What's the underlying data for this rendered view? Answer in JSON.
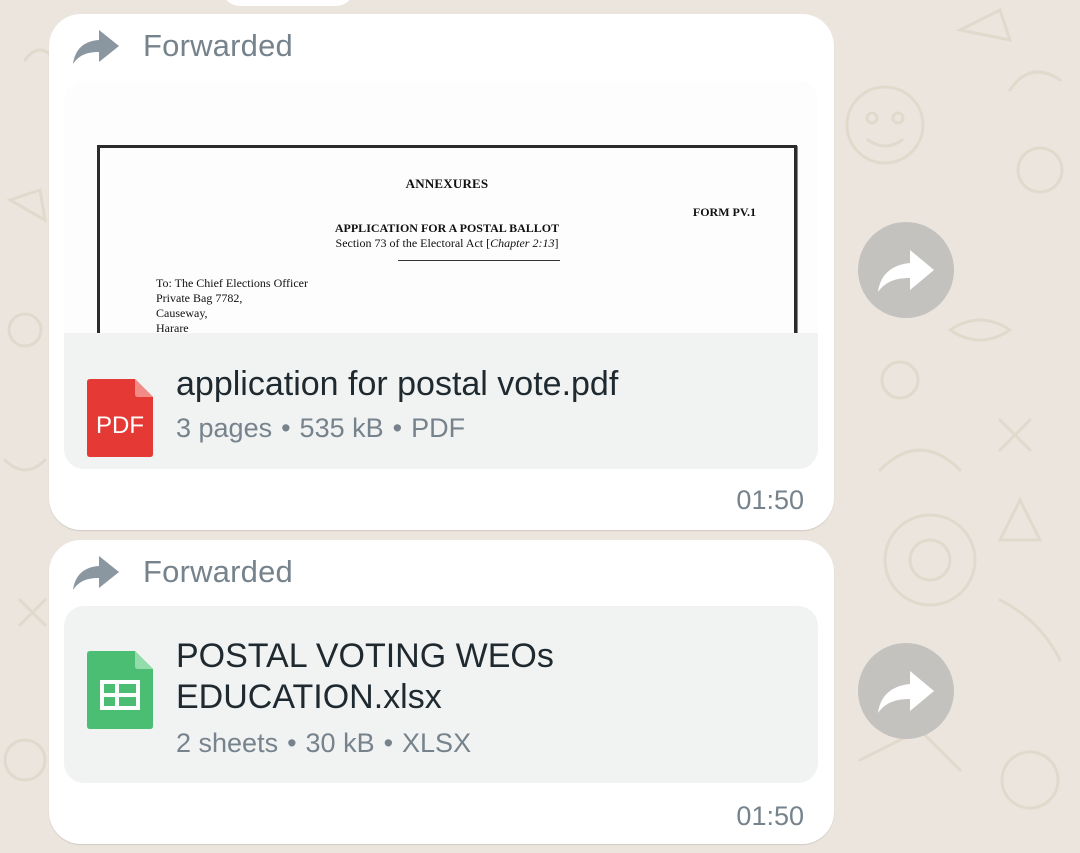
{
  "messages": [
    {
      "forwarded_label": "Forwarded",
      "preview": {
        "heading": "ANNEXURES",
        "form_number": "FORM PV.1",
        "title": "APPLICATION FOR A POSTAL BALLOT",
        "subtitle_prefix": "Section 73 of the Electoral Act [",
        "subtitle_chapter": "Chapter 2:13",
        "subtitle_suffix": "]",
        "address_lines": [
          "To: The Chief Elections Officer",
          "Private Bag 7782,",
          "Causeway,",
          "Harare"
        ]
      },
      "file": {
        "icon": "pdf-file-icon",
        "icon_label": "PDF",
        "icon_color": "#e53935",
        "name": "application for postal vote.pdf",
        "pages": "3 pages",
        "size": "535 kB",
        "type": "PDF"
      },
      "time": "01:50",
      "share_icon": "share-forward-icon"
    },
    {
      "forwarded_label": "Forwarded",
      "file": {
        "icon": "spreadsheet-file-icon",
        "icon_color": "#4cbe73",
        "name": "POSTAL VOTING WEOs EDUCATION.xlsx",
        "sheets": "2 sheets",
        "size": "30 kB",
        "type": "XLSX"
      },
      "time": "01:50",
      "share_icon": "share-forward-icon"
    }
  ],
  "colors": {
    "chat_background": "#ece5dd",
    "bubble": "#ffffff",
    "file_card": "#f1f2f2",
    "meta_text": "#76838c",
    "share_button": "#c4c2bf"
  }
}
